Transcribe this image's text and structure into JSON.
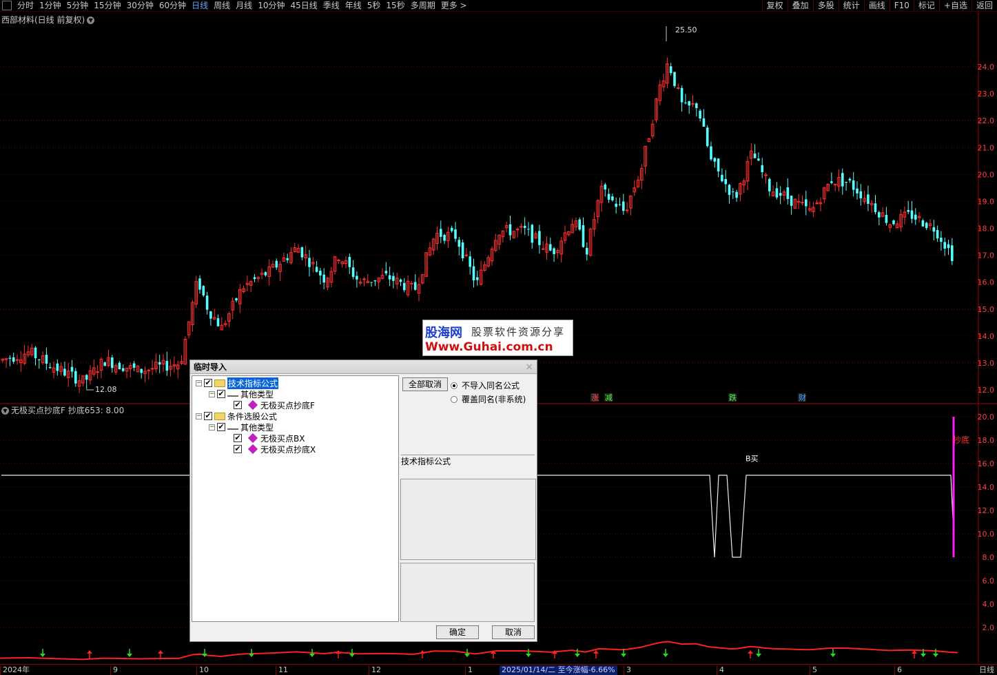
{
  "toolbar": {
    "periods": [
      "分时",
      "1分钟",
      "5分钟",
      "15分钟",
      "30分钟",
      "60分钟",
      "日线",
      "周线",
      "月线",
      "10分钟",
      "45日线",
      "季线",
      "年线",
      "5秒",
      "15秒",
      "多周期",
      "更多 >"
    ],
    "active_period": "日线",
    "right_tools": [
      "复权",
      "叠加",
      "多股",
      "统计",
      "画线",
      "F10",
      "标记",
      "+自选",
      "返回"
    ]
  },
  "chart": {
    "title": "西部材料(日线 前复权)",
    "high_label": "25.50",
    "low_label": "12.08",
    "y_axis": [
      "24.0",
      "23.0",
      "22.0",
      "21.0",
      "20.0",
      "19.0",
      "18.0",
      "17.0",
      "16.0",
      "15.0",
      "14.0",
      "13.0",
      "12.0"
    ],
    "markers": [
      "涨",
      "减",
      "跌",
      "财"
    ]
  },
  "indicator": {
    "title": "无极买点抄底F  抄底653: 8.00",
    "y_axis": [
      "20.0",
      "18.0",
      "16.0",
      "14.0",
      "12.0",
      "10.0",
      "8.0",
      "6.0",
      "4.0",
      "2.0"
    ],
    "signal_label": "B买",
    "bar_label": "抄底"
  },
  "timeline": {
    "labels": [
      "2024年",
      "9",
      "10",
      "11",
      "12",
      "1",
      "3",
      "4",
      "5",
      "6"
    ],
    "highlight": "2025/01/14/二  至今涨幅-6.66%",
    "right": "日线"
  },
  "watermark": {
    "line1": "股海网",
    "line1b": "股票软件资源分享",
    "line2": "Www.Guhai.com.cn"
  },
  "dialog": {
    "title": "临时导入",
    "close": "×",
    "tree": [
      {
        "label": "技术指标公式"
      },
      {
        "label": "其他类型"
      },
      {
        "label": "无极买点抄底F"
      },
      {
        "label": "条件选股公式"
      },
      {
        "label": "其他类型"
      },
      {
        "label": "无极买点BX"
      },
      {
        "label": "无极买点抄底X"
      }
    ],
    "cancel_all": "全部取消",
    "radio_no_import": "不导入同名公式",
    "radio_overwrite": "覆盖同名(非系统)",
    "section_label": "技术指标公式",
    "ok": "确定",
    "cancel": "取消"
  },
  "colors": {
    "up": "#ff3030",
    "down": "#54ffff",
    "grid": "#7a0000",
    "axis_text": "#ff4040",
    "magenta": "#ff20ff"
  }
}
